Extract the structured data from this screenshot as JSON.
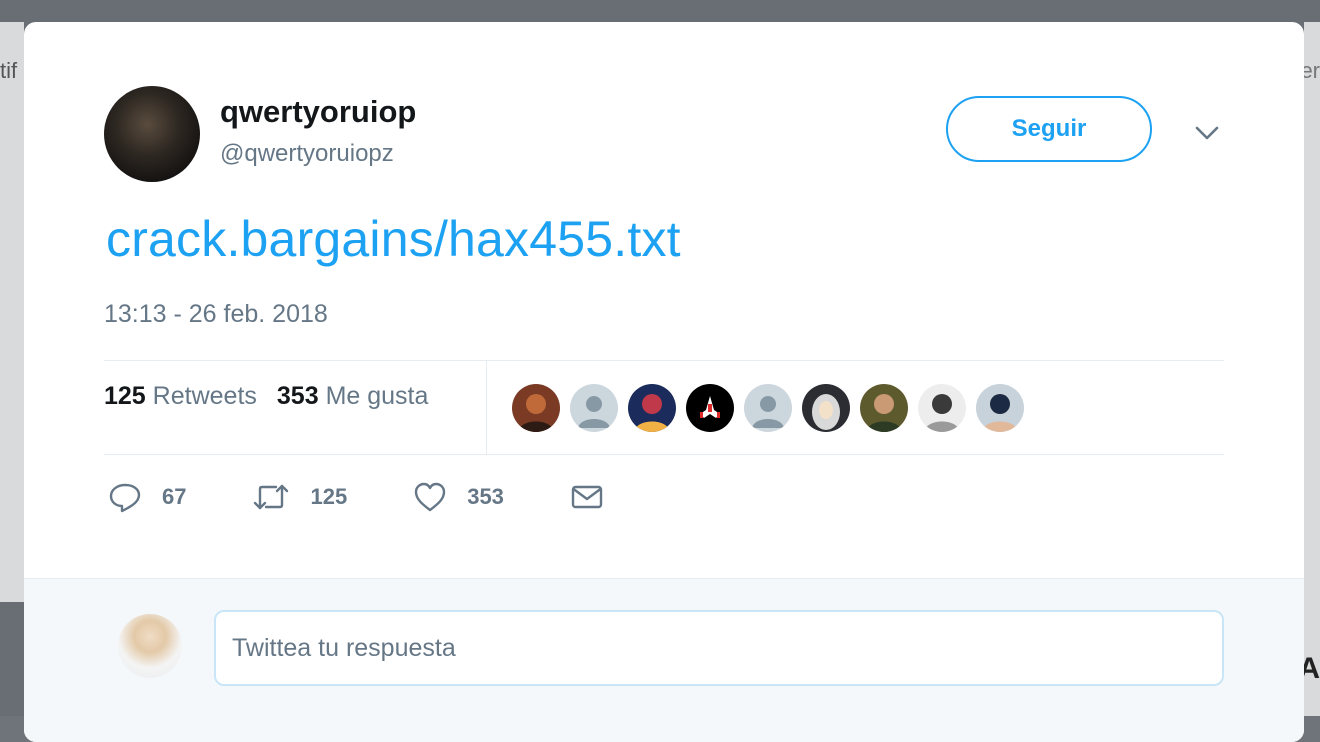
{
  "tweet": {
    "display_name": "qwertyoruiop",
    "handle": "@qwertyoruiopz",
    "follow_label": "Seguir",
    "text": "crack.bargains/hax455.txt",
    "timestamp": "13:13 - 26 feb. 2018",
    "retweets_count": "125",
    "retweets_label": "Retweets",
    "likes_count": "353",
    "likes_label": "Me gusta"
  },
  "actions": {
    "reply_count": "67",
    "retweet_count": "125",
    "like_count": "353"
  },
  "reply": {
    "placeholder": "Twittea tu respuesta"
  },
  "background_fragments": {
    "left_top": "tif",
    "right_top": "er",
    "right_bottom": "A"
  },
  "colors": {
    "accent": "#1da1f2",
    "secondary_text": "#657786",
    "primary_text": "#14171a",
    "divider": "#e6ecf0"
  },
  "likers": [
    {
      "name": "liker-avatar-1",
      "kind": "photo",
      "colors": [
        "#7a3a24",
        "#c06a3a",
        "#2c1a14"
      ]
    },
    {
      "name": "liker-avatar-2",
      "kind": "default",
      "colors": [
        "#ccd6dd",
        "#8899a6"
      ]
    },
    {
      "name": "liker-avatar-3",
      "kind": "photo",
      "colors": [
        "#1a2b5c",
        "#c0394b",
        "#f2b144"
      ]
    },
    {
      "name": "liker-avatar-4",
      "kind": "ship",
      "colors": [
        "#000000",
        "#e12b2b",
        "#ffffff"
      ]
    },
    {
      "name": "liker-avatar-5",
      "kind": "default",
      "colors": [
        "#ccd6dd",
        "#8899a6"
      ]
    },
    {
      "name": "liker-avatar-6",
      "kind": "hooded",
      "colors": [
        "#2b2d33",
        "#d9d9d9",
        "#f3e1c9"
      ]
    },
    {
      "name": "liker-avatar-7",
      "kind": "photo",
      "colors": [
        "#5d5a2e",
        "#c99a74",
        "#2e3b24"
      ]
    },
    {
      "name": "liker-avatar-8",
      "kind": "photo",
      "colors": [
        "#ededed",
        "#3a3a3a",
        "#9a9a9a"
      ]
    },
    {
      "name": "liker-avatar-9",
      "kind": "photo",
      "colors": [
        "#c7d2db",
        "#1d2a44",
        "#e2b89a"
      ]
    }
  ]
}
